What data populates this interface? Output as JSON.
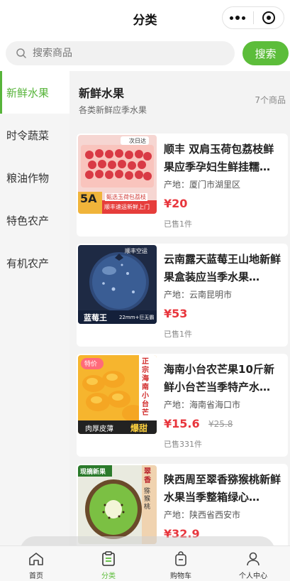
{
  "header": {
    "title": "分类"
  },
  "search": {
    "placeholder": "搜索商品",
    "button_label": "搜索"
  },
  "sidebar": {
    "items": [
      {
        "label": "新鲜水果",
        "active": true
      },
      {
        "label": "时令蔬菜",
        "active": false
      },
      {
        "label": "粮油作物",
        "active": false
      },
      {
        "label": "特色农产",
        "active": false
      },
      {
        "label": "有机农产",
        "active": false
      }
    ]
  },
  "category": {
    "title": "新鲜水果",
    "description": "各类新鲜应季水果",
    "count": "7个商品"
  },
  "products": [
    {
      "name": "顺丰 双肩玉荷包荔枝鲜果应季孕妇生鲜挂糯…",
      "origin": "产地：厦门市湖里区",
      "price": "¥20",
      "old_price": "",
      "sold": "已售1件",
      "image_text": "5A",
      "image_caption": "甄选玉荷包荔枝",
      "image_tag": "次日达",
      "image_brand": "顺丰速运新鲜上门"
    },
    {
      "name": "云南露天蓝莓王山地新鲜果盒装应当季水果…",
      "origin": "产地：云南昆明市",
      "price": "¥53",
      "old_price": "",
      "sold": "已售1件",
      "image_text": "蓝莓王",
      "image_caption": "22mm+巨无霸",
      "image_tag": "顺丰空运",
      "image_brand": ""
    },
    {
      "name": "海南小台农芒果10斤新鲜小台芒当季特产水…",
      "origin": "产地：海南省海口市",
      "price": "¥15.6",
      "old_price": "¥25.8",
      "sold": "已售331件",
      "image_text": "特价",
      "image_caption": "肉厚皮薄",
      "image_tag": "爆甜",
      "image_brand": "正宗海南小台芒"
    },
    {
      "name": "陕西周至翠香猕猴桃新鲜水果当季整箱绿心…",
      "origin": "产地：陕西省西安市",
      "price": "¥32.9",
      "old_price": "",
      "sold": "",
      "image_text": "现摘新果",
      "image_caption": "猕猴桃",
      "image_tag": "翠香",
      "image_brand": ""
    }
  ],
  "tabbar": {
    "items": [
      {
        "label": "首页",
        "icon": "home-icon",
        "active": false
      },
      {
        "label": "分类",
        "icon": "category-icon",
        "active": true
      },
      {
        "label": "购物车",
        "icon": "cart-icon",
        "active": false
      },
      {
        "label": "个人中心",
        "icon": "user-icon",
        "active": false
      }
    ]
  },
  "colors": {
    "accent": "#5cbd3a",
    "price": "#e8363d"
  }
}
